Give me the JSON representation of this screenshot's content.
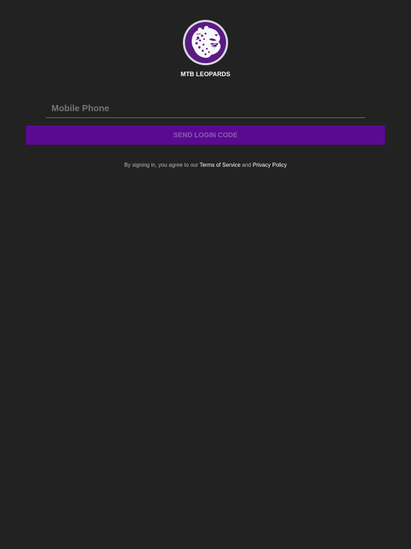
{
  "brand": {
    "name": "MTB LEOPARDS",
    "logo_icon": "leopard-head-icon",
    "circle_color": "#5a1a86"
  },
  "login": {
    "phone_placeholder": "Mobile Phone",
    "phone_value": "",
    "send_label": "SEND LOGIN CODE"
  },
  "legal": {
    "prefix": "By signing in, you agree to our",
    "terms": "Terms of Service",
    "joiner": "and",
    "privacy": "Privacy Policy"
  },
  "colors": {
    "background": "#222222",
    "button": "#5a0a91",
    "button_text": "#8a5fad"
  }
}
